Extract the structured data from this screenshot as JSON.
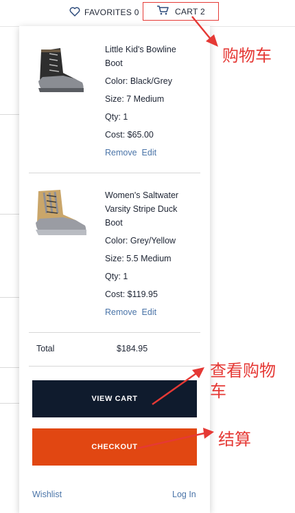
{
  "header": {
    "favorites_label": "FAVORITES 0",
    "cart_label": "CART 2"
  },
  "cart": {
    "items": [
      {
        "name": "Little Kid's Bowline Boot",
        "color": "Color: Black/Grey",
        "size": "Size: 7 Medium",
        "qty": "Qty: 1",
        "cost": "Cost: $65.00",
        "remove_label": "Remove",
        "edit_label": "Edit",
        "image_icon": "black-grey-duck-boot"
      },
      {
        "name": "Women's Saltwater Varsity Stripe Duck Boot",
        "color": "Color: Grey/Yellow",
        "size": "Size: 5.5 Medium",
        "qty": "Qty: 1",
        "cost": "Cost: $119.95",
        "remove_label": "Remove",
        "edit_label": "Edit",
        "image_icon": "grey-yellow-duck-boot"
      }
    ],
    "total_label": "Total",
    "total_value": "$184.95",
    "view_cart_label": "VIEW CART",
    "checkout_label": "CHECKOUT",
    "wishlist_label": "Wishlist",
    "login_label": "Log In"
  },
  "annotations": {
    "cart": "购物车",
    "view_cart": "查看购物车",
    "checkout": "结算"
  },
  "colors": {
    "navy": "#0f1b2d",
    "checkout": "#e14712",
    "link": "#4a74a8",
    "annotation_red": "#e53935"
  }
}
